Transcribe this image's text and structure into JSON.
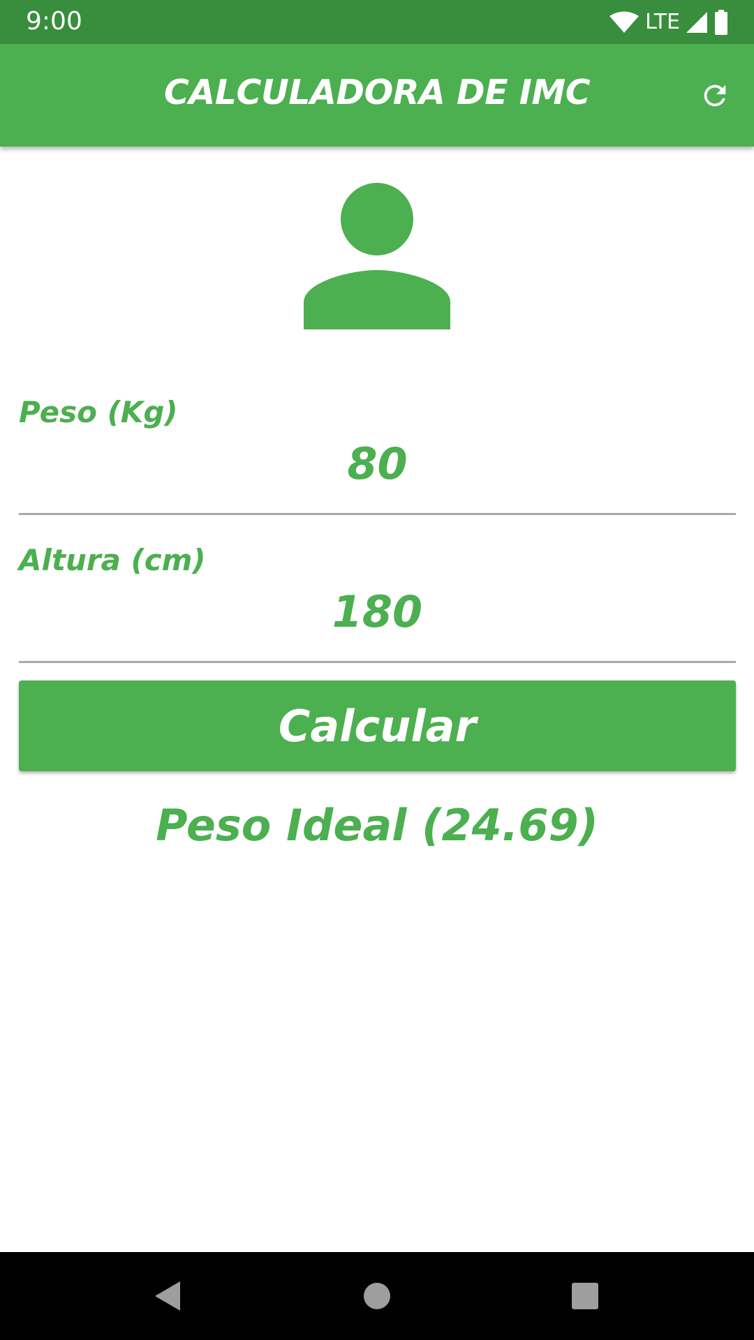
{
  "status_bar": {
    "time": "9:00",
    "network": "LTE",
    "icons": [
      "wifi-icon",
      "signal-icon",
      "battery-icon"
    ]
  },
  "app_bar": {
    "title": "CALCULADORA DE IMC",
    "action_icon": "refresh-icon"
  },
  "avatar_icon": "person-icon",
  "form": {
    "weight": {
      "label": "Peso (Kg)",
      "value": "80"
    },
    "height": {
      "label": "Altura (cm)",
      "value": "180"
    },
    "submit_label": "Calcular"
  },
  "result": {
    "text": "Peso Ideal (24.69)"
  },
  "nav_bar": {
    "icons": [
      "back-icon",
      "home-icon",
      "recents-icon"
    ]
  },
  "colors": {
    "primary": "#4caf50",
    "primary_dark": "#388e3c",
    "divider": "#a8a8a8",
    "nav_icon": "#9e9e9e"
  }
}
